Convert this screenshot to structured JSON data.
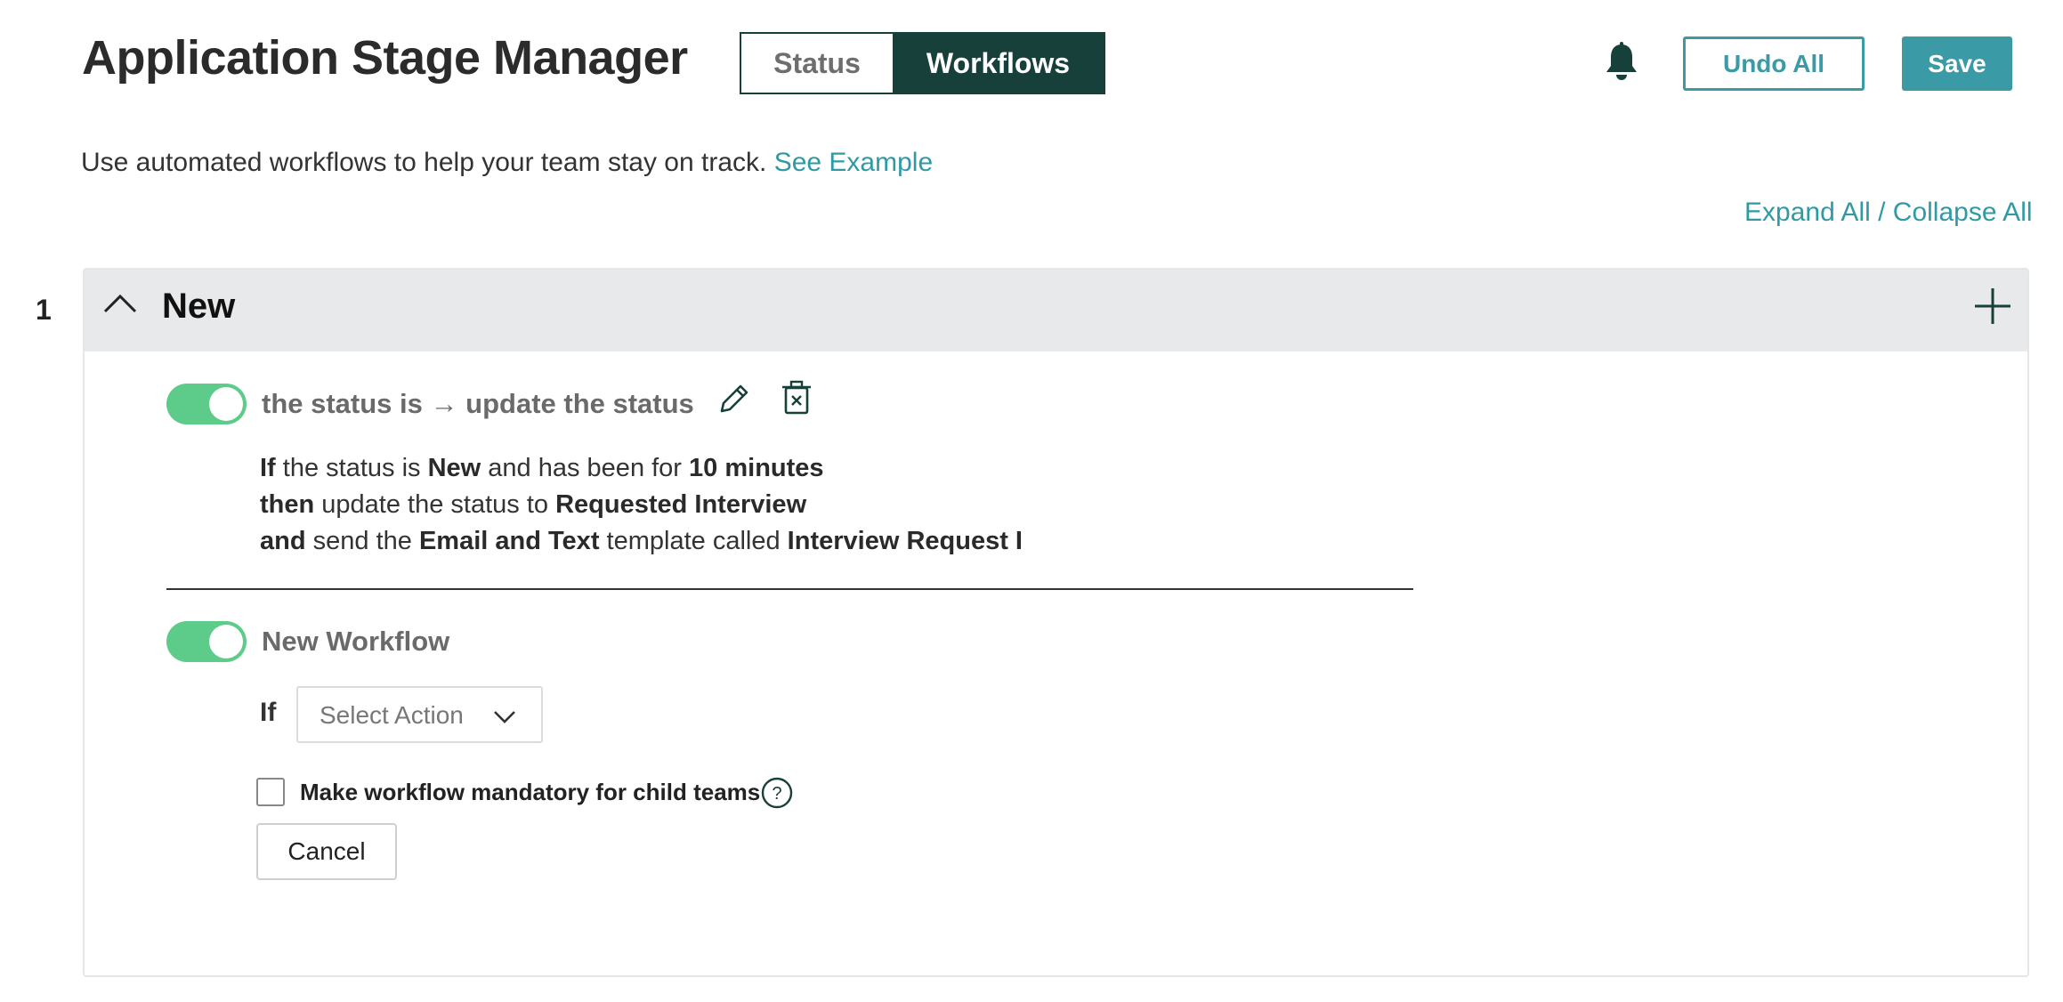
{
  "header": {
    "title": "Application Stage Manager",
    "tabs": [
      {
        "label": "Status",
        "active": false
      },
      {
        "label": "Workflows",
        "active": true
      }
    ],
    "notification_icon": "bell-icon",
    "undo_label": "Undo All",
    "save_label": "Save"
  },
  "intro": {
    "text": "Use automated workflows to help your team stay on track.",
    "link": "See Example"
  },
  "expand_collapse_label": "Expand All / Collapse All",
  "stage": {
    "number": "1",
    "name": "New",
    "workflows": [
      {
        "enabled": true,
        "title_start": "the status is",
        "arrow": "→",
        "title_end": "update the status",
        "if_kw": "If",
        "if_pre": "the status is",
        "if_status": "New",
        "if_mid": "and has been for",
        "if_duration": "10 minutes",
        "then_kw": "then",
        "then_pre": "update the status to",
        "then_status": "Requested Interview",
        "and_kw": "and",
        "and_pre": "send the",
        "and_template_type": "Email and Text",
        "and_mid": "template called",
        "and_template_name": "Interview Request I"
      }
    ],
    "new_workflow": {
      "enabled": true,
      "title": "New Workflow",
      "if_label": "If",
      "select_placeholder": "Select Action",
      "mandatory_label": "Make workflow mandatory for child teams",
      "mandatory_checked": false,
      "cancel_label": "Cancel"
    }
  },
  "colors": {
    "accent": "#3a9aa5",
    "dark_green": "#17403a",
    "toggle_on": "#5dcb89",
    "stage_header_bg": "#e8e9eb"
  }
}
